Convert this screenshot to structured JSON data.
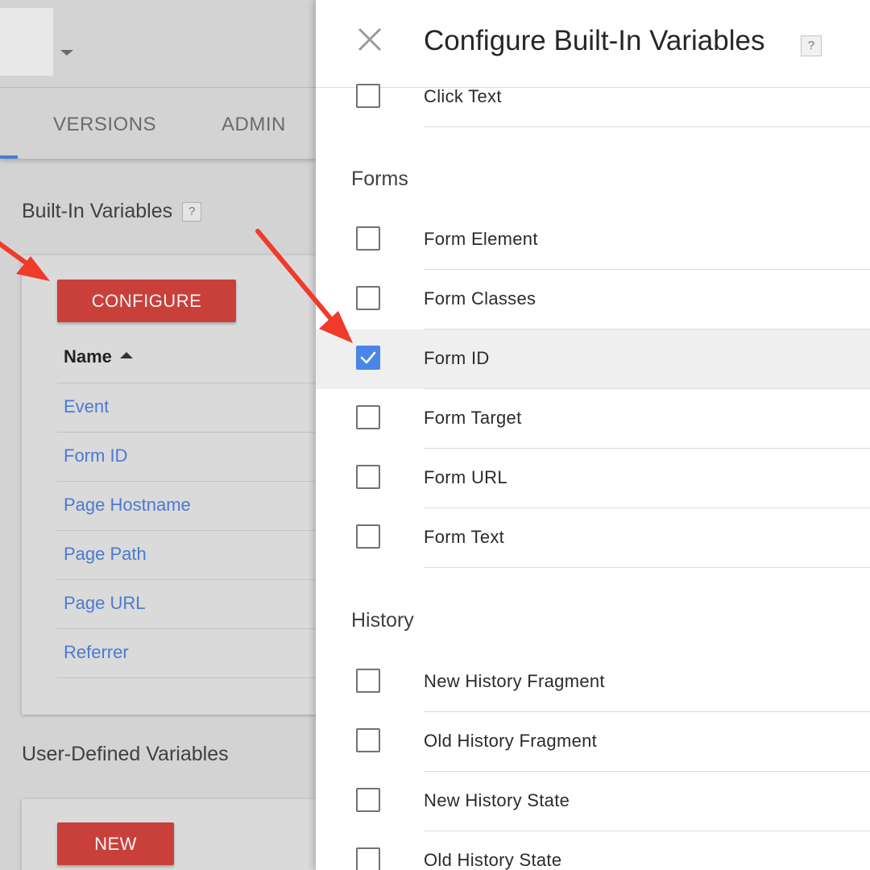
{
  "left": {
    "tabs": [
      {
        "label": "VERSIONS"
      },
      {
        "label": "ADMIN"
      }
    ],
    "builtin_title": "Built-In Variables",
    "help_glyph": "?",
    "configure_label": "CONFIGURE",
    "name_column": "Name",
    "variables": [
      "Event",
      "Form ID",
      "Page Hostname",
      "Page Path",
      "Page URL",
      "Referrer"
    ],
    "user_defined_title": "User-Defined Variables",
    "new_label": "NEW"
  },
  "dialog": {
    "title": "Configure Built-In Variables",
    "help_glyph": "?",
    "top_item": {
      "label": "Click Text",
      "checked": false
    },
    "groups": [
      {
        "label": "Forms",
        "items": [
          {
            "label": "Form Element",
            "checked": false
          },
          {
            "label": "Form Classes",
            "checked": false
          },
          {
            "label": "Form ID",
            "checked": true
          },
          {
            "label": "Form Target",
            "checked": false
          },
          {
            "label": "Form URL",
            "checked": false
          },
          {
            "label": "Form Text",
            "checked": false
          }
        ]
      },
      {
        "label": "History",
        "items": [
          {
            "label": "New History Fragment",
            "checked": false
          },
          {
            "label": "Old History Fragment",
            "checked": false
          },
          {
            "label": "New History State",
            "checked": false
          },
          {
            "label": "Old History State",
            "checked": false
          }
        ]
      }
    ]
  },
  "colors": {
    "accent_red": "#c9403a",
    "link_blue": "#4a7bd0",
    "checkbox_blue": "#4a86e8",
    "annotation_arrow": "#f03a2a"
  }
}
